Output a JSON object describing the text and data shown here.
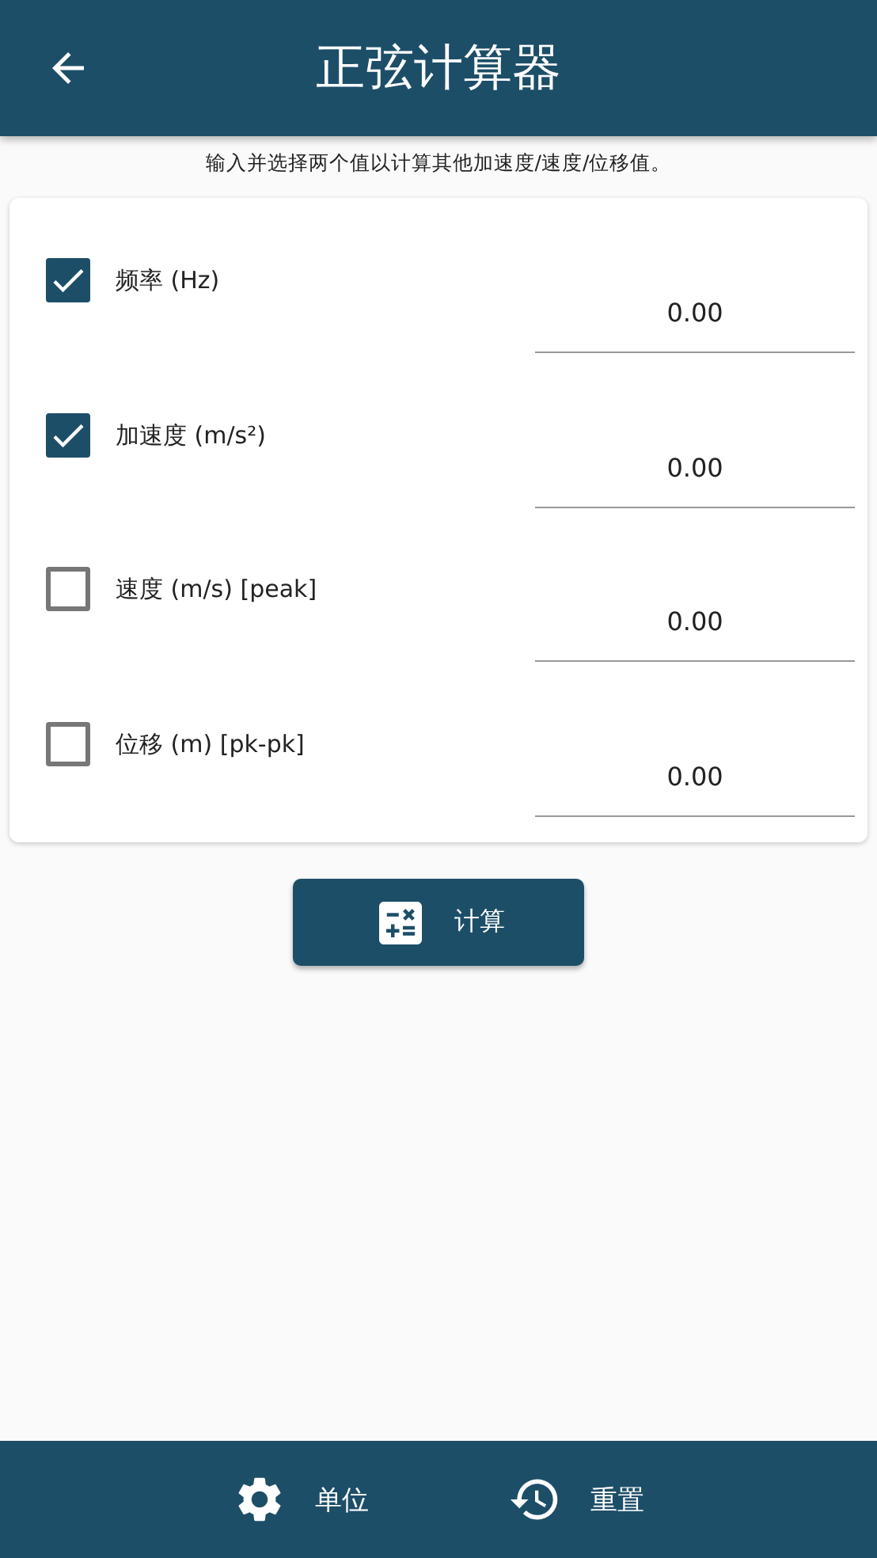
{
  "header": {
    "title": "正弦计算器"
  },
  "instruction": "输入并选择两个值以计算其他加速度/速度/位移值。",
  "fields": [
    {
      "label": "频率 (Hz)",
      "checked": true,
      "value": "0.00"
    },
    {
      "label": "加速度 (m/s²)",
      "checked": true,
      "value": "0.00"
    },
    {
      "label": "速度 (m/s) [peak]",
      "checked": false,
      "value": "0.00"
    },
    {
      "label": "位移 (m) [pk-pk]",
      "checked": false,
      "value": "0.00"
    }
  ],
  "calculate_button": "计算",
  "bottom_bar": [
    {
      "kind": "units",
      "label": "单位"
    },
    {
      "kind": "reset",
      "label": "重置"
    }
  ]
}
